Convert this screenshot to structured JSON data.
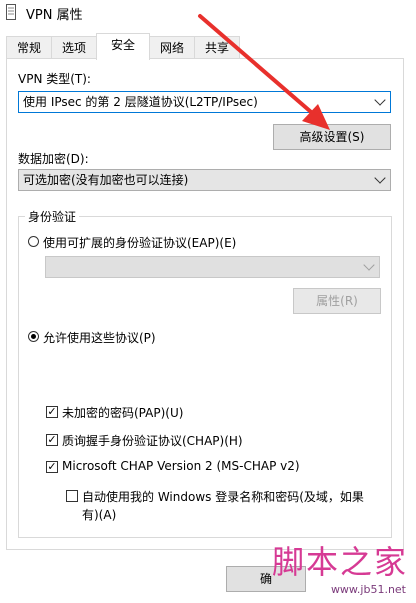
{
  "window": {
    "title": "VPN 属性"
  },
  "tabs": [
    {
      "label": "常规"
    },
    {
      "label": "选项"
    },
    {
      "label": "安全"
    },
    {
      "label": "网络"
    },
    {
      "label": "共享"
    }
  ],
  "vpn_type": {
    "label": "VPN 类型(T):",
    "value": "使用 IPsec 的第 2 层隧道协议(L2TP/IPsec)"
  },
  "advanced_button": {
    "label": "高级设置(S)"
  },
  "encryption": {
    "label": "数据加密(D):",
    "value": "可选加密(没有加密也可以连接)"
  },
  "auth": {
    "group_title": "身份验证",
    "eap_radio": "使用可扩展的身份验证协议(EAP)(E)",
    "eap_combo": "",
    "properties_button": "属性(R)",
    "allow_radio": "允许使用这些协议(P)",
    "pap": "未加密的密码(PAP)(U)",
    "chap": "质询握手身份验证协议(CHAP)(H)",
    "mschap": "Microsoft CHAP Version 2 (MS-CHAP v2)",
    "auto_logon_line1": "自动使用我的 Windows 登录名称和密码(及域，如果",
    "auto_logon_line2": "有)(A)"
  },
  "ok_button": {
    "label": "确"
  },
  "watermark": {
    "main": "脚本之家",
    "url": "www.jb51.net"
  },
  "colors": {
    "accent": "#0078d7",
    "arrow": "#e8302c",
    "watermark": "#d63a94"
  },
  "state": {
    "active_tab": "安全",
    "selected_radio": "allow",
    "pap_checked": true,
    "chap_checked": true,
    "mschap_checked": true,
    "auto_logon_checked": false
  }
}
